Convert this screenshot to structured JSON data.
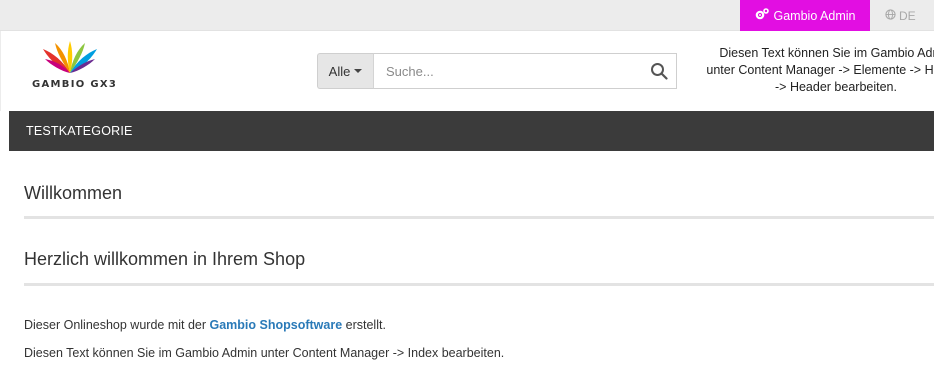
{
  "topbar": {
    "admin_label": "Gambio Admin",
    "admin_icon": "gears-icon",
    "admin_color": "#e20ee2",
    "language_label": "DE",
    "language_icon": "globe-icon"
  },
  "header": {
    "logo_text": "GAMBIO GX3",
    "search": {
      "category_label": "Alle",
      "placeholder": "Suche...",
      "value": ""
    },
    "info_lines": [
      "Diesen Text können Sie im Gambio Admin",
      "unter Content Manager -> Elemente -> Header",
      "-> Header bearbeiten."
    ]
  },
  "nav": {
    "items": [
      {
        "label": "TESTKATEGORIE"
      }
    ],
    "background": "#3b3b3b"
  },
  "main": {
    "heading1": "Willkommen",
    "heading2": "Herzlich willkommen in Ihrem Shop",
    "paragraph1": {
      "before": "Dieser Onlineshop wurde mit der ",
      "link": "Gambio Shopsoftware",
      "after": " erstellt."
    },
    "paragraph2": "Diesen Text können Sie im Gambio Admin unter Content Manager -> Index bearbeiten.",
    "link_color": "#2a7ab8"
  }
}
